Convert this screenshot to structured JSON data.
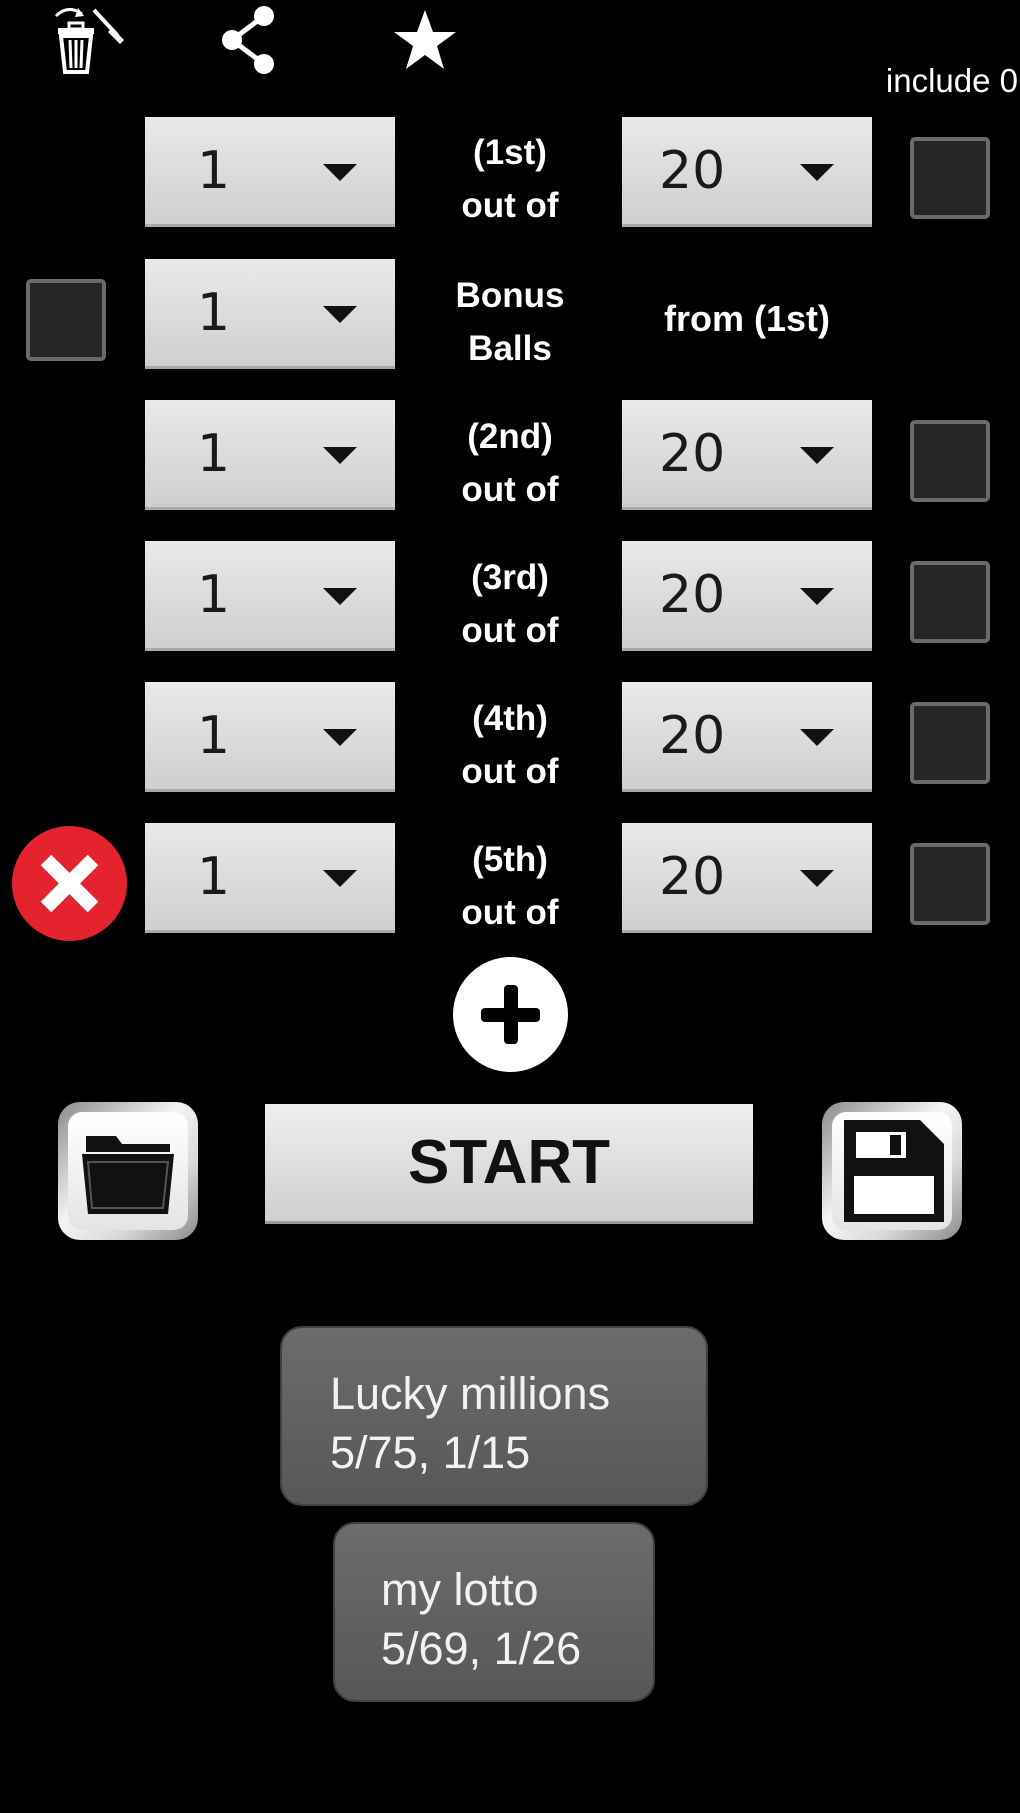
{
  "toolbar": {
    "icons": [
      "trash-refresh-icon",
      "share-icon",
      "star-icon"
    ],
    "include_zero_label": "include 0"
  },
  "rows": [
    {
      "count": "1",
      "label_line1": "(1st)",
      "label_line2": "out of",
      "max": "20",
      "include_zero_checked": false
    },
    {
      "count": "1",
      "label_line1": "(2nd)",
      "label_line2": "out of",
      "max": "20",
      "include_zero_checked": false
    },
    {
      "count": "1",
      "label_line1": "(3rd)",
      "label_line2": "out of",
      "max": "20",
      "include_zero_checked": false
    },
    {
      "count": "1",
      "label_line1": "(4th)",
      "label_line2": "out of",
      "max": "20",
      "include_zero_checked": false
    },
    {
      "count": "1",
      "label_line1": "(5th)",
      "label_line2": "out of",
      "max": "20",
      "include_zero_checked": false
    }
  ],
  "bonus": {
    "enabled_checked": false,
    "count": "1",
    "label_line1": "Bonus",
    "label_line2": "Balls",
    "from_label": "from (1st)"
  },
  "actions": {
    "start_label": "START",
    "open_icon": "folder-icon",
    "save_icon": "floppy-disk-icon",
    "add_icon": "plus-icon",
    "delete_icon": "close-icon"
  },
  "saved_games": [
    {
      "name": "Lucky millions",
      "config": "5/75, 1/15"
    },
    {
      "name": "my lotto",
      "config": "5/69, 1/26"
    }
  ],
  "colors": {
    "background": "#000000",
    "delete_red": "#e5232f",
    "spinner_gray": "#d9d9d9",
    "saved_button_gray": "#626262"
  }
}
